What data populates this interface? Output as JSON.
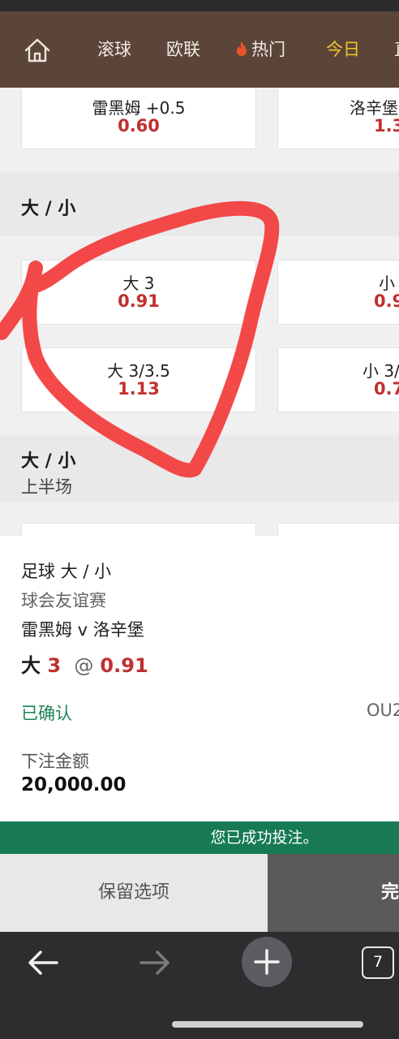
{
  "nav": {
    "items": [
      "滚球",
      "欧联",
      "热门",
      "今日",
      "直"
    ],
    "active_index": 3,
    "active_color": "#f1c232",
    "background": "#5a4538"
  },
  "handicap_row": {
    "left_label": "雷黑姆 +0.5",
    "left_odd": "0.60",
    "right_label": "洛辛堡",
    "right_odd": "1.3"
  },
  "ou_full": {
    "title": "大 / 小",
    "rows": [
      {
        "over_label": "大 3",
        "over_odd": "0.91",
        "under_label": "小",
        "under_odd": "0.9"
      },
      {
        "over_label": "大 3/3.5",
        "over_odd": "1.13",
        "under_label": "小 3/",
        "under_odd": "0.7"
      }
    ]
  },
  "ou_half": {
    "title": "大 / 小",
    "subtitle": "上半场"
  },
  "betslip": {
    "bet_type": "足球 大 / 小",
    "league": "球会友谊赛",
    "match": "雷黑姆 v 洛辛堡",
    "pick_side": "大",
    "pick_line": "3",
    "pick_at": "@",
    "pick_odd": "0.91",
    "status": "已确认",
    "ref": "OU2",
    "stake_label": "下注金额",
    "stake": "20,000.00"
  },
  "success_message": "您已成功投注。",
  "buttons": {
    "keep": "保留选项",
    "done": "完成"
  },
  "browser": {
    "tab_count": "7"
  },
  "colors": {
    "odds_red": "#c0302f",
    "confirm_green": "#1c8454",
    "success_bar": "#177a55",
    "annotation_red": "#f23b3b"
  }
}
